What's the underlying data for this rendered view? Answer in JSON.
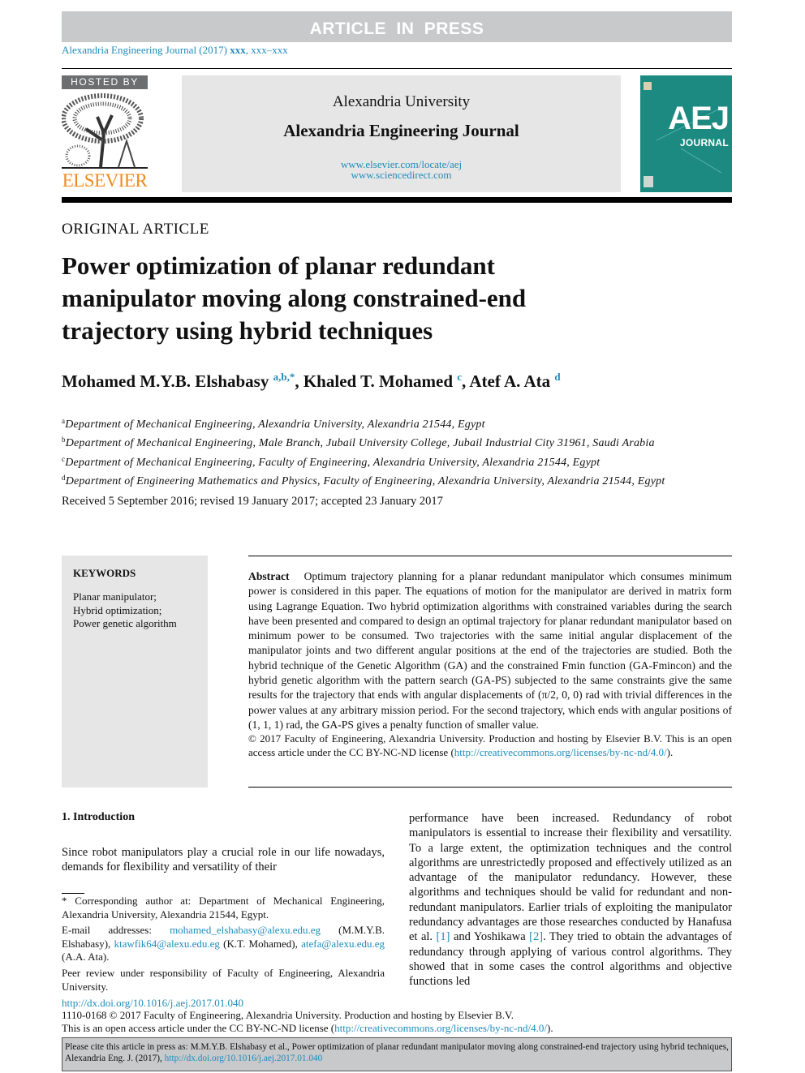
{
  "banner": "ARTICLE IN PRESS",
  "journal_ref": {
    "text": "Alexandria Engineering Journal (2017) ",
    "vol": "xxx",
    "pages": ", xxx–xxx"
  },
  "header": {
    "hosted_by": "HOSTED BY",
    "publisher_logo": "ELSEVIER",
    "university": "Alexandria University",
    "journal": "Alexandria Engineering Journal",
    "url1": "www.elsevier.com/locate/aej",
    "url2": "www.sciencedirect.com",
    "cover_text": "AEJ JOURNAL"
  },
  "article_type": "ORIGINAL ARTICLE",
  "title": "Power optimization of planar redundant manipulator moving along constrained-end trajectory using hybrid techniques",
  "authors": [
    {
      "name": "Mohamed M.Y.B. Elshabasy",
      "sup": "a,b,*"
    },
    {
      "name": "Khaled T. Mohamed",
      "sup": "c"
    },
    {
      "name": "Atef A. Ata",
      "sup": "d"
    }
  ],
  "affiliations": [
    {
      "mark": "a",
      "text": "Department of Mechanical Engineering, Alexandria University, Alexandria 21544, Egypt"
    },
    {
      "mark": "b",
      "text": "Department of Mechanical Engineering, Male Branch, Jubail University College, Jubail Industrial City 31961, Saudi Arabia"
    },
    {
      "mark": "c",
      "text": "Department of Mechanical Engineering, Faculty of Engineering, Alexandria University, Alexandria 21544, Egypt"
    },
    {
      "mark": "d",
      "text": "Department of Engineering Mathematics and Physics, Faculty of Engineering, Alexandria University, Alexandria 21544, Egypt"
    }
  ],
  "received": "Received 5 September 2016; revised 19 January 2017; accepted 23 January 2017",
  "keywords": {
    "heading": "KEYWORDS",
    "items": [
      "Planar manipulator;",
      "Hybrid optimization;",
      "Power genetic algorithm"
    ]
  },
  "abstract": {
    "label": "Abstract",
    "text": "Optimum trajectory planning for a planar redundant manipulator which consumes minimum power is considered in this paper. The equations of motion for the manipulator are derived in matrix form using Lagrange Equation. Two hybrid optimization algorithms with constrained variables during the search have been presented and compared to design an optimal trajectory for planar redundant manipulator based on minimum power to be consumed. Two trajectories with the same initial angular displacement of the manipulator joints and two different angular positions at the end of the trajectories are studied. Both the hybrid technique of the Genetic Algorithm (GA) and the constrained Fmin function (GA-Fmincon) and the hybrid genetic algorithm with the pattern search (GA-PS) subjected to the same constraints give the same results for the trajectory that ends with angular displacements of (π/2, 0, 0) rad with trivial differences in the power values at any arbitrary mission period. For the second trajectory, which ends with angular positions of (1, 1, 1) rad, the GA-PS gives a penalty function of smaller value.",
    "copyright": "© 2017 Faculty of Engineering, Alexandria University. Production and hosting by Elsevier B.V. This is an open access article under the CC BY-NC-ND license (",
    "license_url": "http://creativecommons.org/licenses/by-nc-nd/4.0/",
    "copyright_end": ")."
  },
  "intro": {
    "heading": "1. Introduction",
    "para": "Since robot manipulators play a crucial role in our life nowadays, demands for flexibility and versatility of their",
    "right_a": "performance have been increased. Redundancy of robot manipulators is essential to increase their flexibility and versatility. To a large extent, the optimization techniques and the control algorithms are unrestrictedly proposed and effectively utilized as an advantage of the manipulator redundancy. However, these algorithms and techniques should be valid for redundant and non-redundant manipulators. Earlier trials of exploiting the manipulator redundancy advantages are those researches conducted by Hanafusa et al. ",
    "ref1": "[1]",
    "right_b": " and Yoshikawa ",
    "ref2": "[2]",
    "right_c": ". They tried to obtain the advantages of redundancy through applying of various control algorithms. They showed that in some cases the control algorithms and objective functions led"
  },
  "footnote": {
    "corresponding": "* Corresponding author at: Department of Mechanical Engineering, Alexandria University, Alexandria 21544, Egypt.",
    "email_label": "E-mail addresses: ",
    "email1": "mohamed_elshabasy@alexu.edu.eg",
    "email1_who": " (M.M.Y.B. Elshabasy), ",
    "email2": "ktawfik64@alexu.edu.eg",
    "email2_who": " (K.T. Mohamed), ",
    "email3": "atefa@alexu.edu.eg",
    "email3_who": " (A.A. Ata).",
    "peer": "Peer review under responsibility of Faculty of Engineering, Alexandria University."
  },
  "bottom": {
    "doi": "http://dx.doi.org/10.1016/j.aej.2017.01.040",
    "issn": "1110-0168 © 2017 Faculty of Engineering, Alexandria University. Production and hosting by Elsevier B.V.",
    "oa": "This is an open access article under the CC BY-NC-ND license (",
    "oa_url": "http://creativecommons.org/licenses/by-nc-nd/4.0/",
    "oa_end": ")."
  },
  "cite": {
    "text": "Please cite this article in press as: M.M.Y.B. Elshabasy et al., Power optimization of planar redundant manipulator moving along constrained-end trajectory using hybrid techniques,  Alexandria Eng. J. (2017), ",
    "url": "http://dx.doi.org/10.1016/j.aej.2017.01.040"
  },
  "colors": {
    "link": "#1f8cba",
    "banner": "#c8c9cb",
    "elsevier": "#f08a1c",
    "cover": "#1c8a80"
  }
}
